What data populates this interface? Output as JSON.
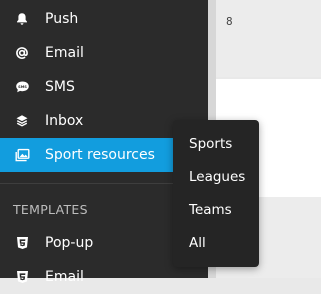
{
  "sidebar": {
    "items": [
      {
        "label": "Push",
        "icon": "bell-icon"
      },
      {
        "label": "Email",
        "icon": "at-icon"
      },
      {
        "label": "SMS",
        "icon": "sms-icon"
      },
      {
        "label": "Inbox",
        "icon": "layers-icon"
      },
      {
        "label": "Sport resources",
        "icon": "image-gallery-icon",
        "active": true
      }
    ],
    "section_title": "TEMPLATES",
    "template_items": [
      {
        "label": "Pop-up",
        "icon": "html5-icon"
      },
      {
        "label": "Email",
        "icon": "html5-icon"
      }
    ]
  },
  "content": {
    "value": "8"
  },
  "dropdown": {
    "items": [
      "Sports",
      "Leagues",
      "Teams",
      "All"
    ]
  },
  "colors": {
    "sidebar_bg": "#2b2b2b",
    "active_bg": "#129dde",
    "dropdown_bg": "#252525"
  }
}
